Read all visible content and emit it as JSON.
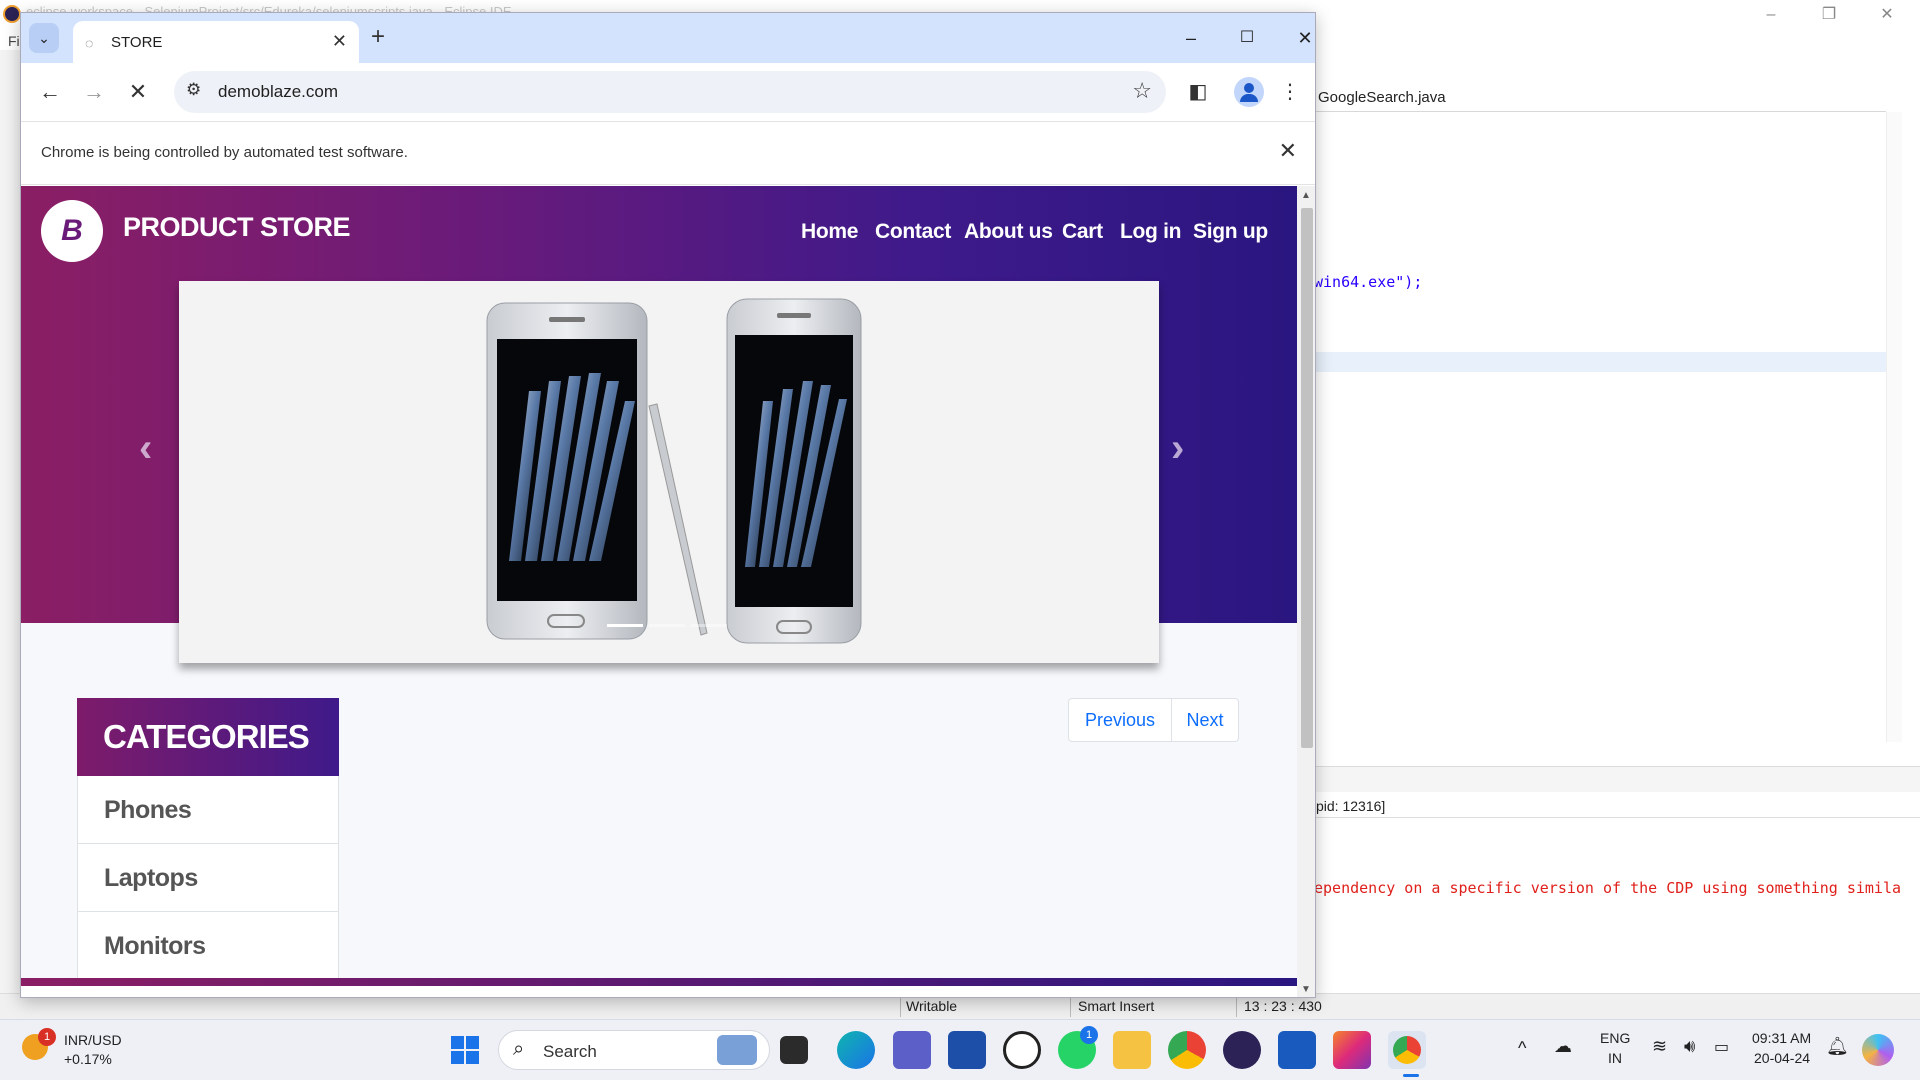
{
  "ide": {
    "title": "eclipse-workspace - SeleniumProject/src/Edureka/seleniumscripts.java - Eclipse IDE",
    "menu_first": "Fi",
    "editor_tab": "GoogleSearch.java",
    "code_fragment": "win64.exe\");",
    "console_header": "pid: 12316]",
    "console_error": "ependency on a specific version of the CDP using something simila",
    "status": {
      "mode": "Writable",
      "insert": "Smart Insert",
      "position": "13 : 23 : 430"
    }
  },
  "chrome": {
    "tab_title": "STORE",
    "url": "demoblaze.com",
    "infobar_text": "Chrome is being controlled by automated test software."
  },
  "page": {
    "brand_logo_letter": "B",
    "brand_name": "PRODUCT STORE",
    "nav": [
      "Home",
      "Contact",
      "About us",
      "Cart",
      "Log in",
      "Sign up"
    ],
    "categories_title": "CATEGORIES",
    "categories": [
      "Phones",
      "Laptops",
      "Monitors"
    ],
    "pager": {
      "previous": "Previous",
      "next": "Next"
    },
    "carousel_prev_glyph": "‹",
    "carousel_next_glyph": "›"
  },
  "taskbar": {
    "widget_title": "INR/USD",
    "widget_value": "+0.17%",
    "widget_badge": "1",
    "search_placeholder": "Search",
    "whatsapp_badge": "1",
    "language_line1": "ENG",
    "language_line2": "IN",
    "time": "09:31 AM",
    "date": "20-04-24"
  },
  "colors": {
    "brand_gradient_start": "#8b1e64",
    "brand_gradient_end": "#2a1680",
    "link_blue": "#0d6efd",
    "chrome_tabbar": "#d3e3fd"
  }
}
